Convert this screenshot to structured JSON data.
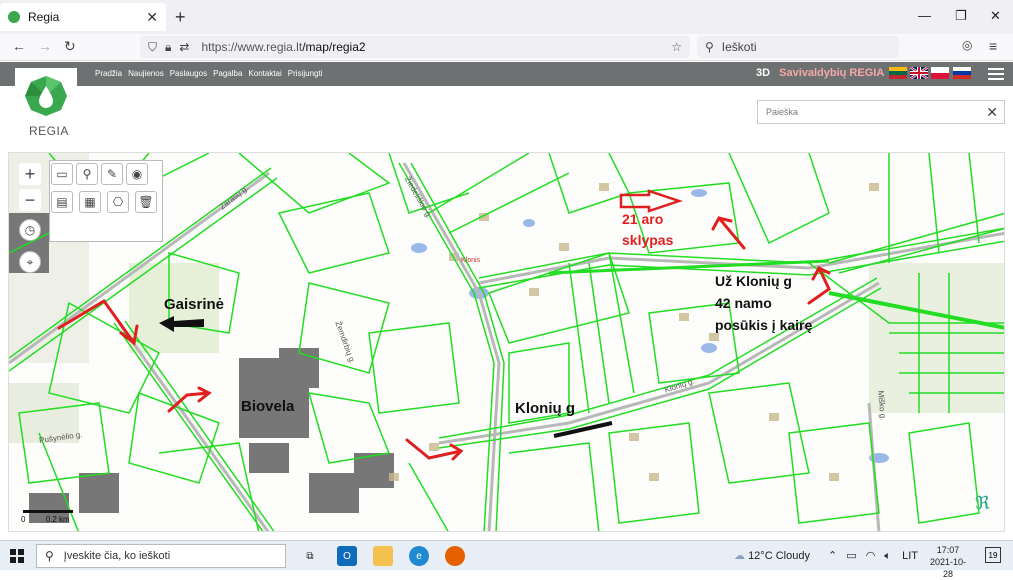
{
  "browser": {
    "tab_title": "Regia",
    "tab_close": "✕",
    "new_tab": "+",
    "url_host": "https://www.regia.lt",
    "url_path": "/map/regia2",
    "search_placeholder": "Ieškoti",
    "window_controls": {
      "minimize": "—",
      "restore": "❐",
      "close": "✕"
    }
  },
  "site": {
    "menu": [
      "Pradžia",
      "Naujienos",
      "Paslaugos",
      "Pagalba",
      "Kontaktai",
      "Prisijungti"
    ],
    "three_d": "3D",
    "title": "Savivaldybių REGIA",
    "logo_text": "REGIA",
    "search_placeholder": "Paieška",
    "search_clear": "✕",
    "colors": {
      "topbar": "#6d7171",
      "brand": "#3aa84e",
      "parcel_lines": "#22dd22",
      "annotation_red": "#e02020"
    }
  },
  "map": {
    "zoom_in": "+",
    "zoom_out": "−",
    "scale": {
      "left_label": "0",
      "right_label": "0.2 km"
    },
    "annotations": {
      "gaisrine": "Gaisrinė",
      "biovela": "Biovela",
      "kloniu": "Klonių g",
      "aro_line1": "21 aro",
      "aro_line2": "sklypas",
      "uz_line1": "Už Klonių g",
      "uz_line2": "42 namo",
      "uz_line3": "posūkis į kairę"
    },
    "street_labels": {
      "zarasu": "Zarasų g.",
      "ziediskio": "Žiedeliškio g.",
      "zemdirbiu": "Žemdirbių g.",
      "klonio": "Klonių g.",
      "pusynelio": "Pušynėlio g.",
      "klonis": "Klonis",
      "miske": "Miško g."
    }
  },
  "taskbar": {
    "search_placeholder": "Įveskite čia, ko ieškoti",
    "weather": "12°C  Cloudy",
    "lang": "LIT",
    "time": "17:07",
    "date": "2021-10-28",
    "notifications": "19"
  }
}
